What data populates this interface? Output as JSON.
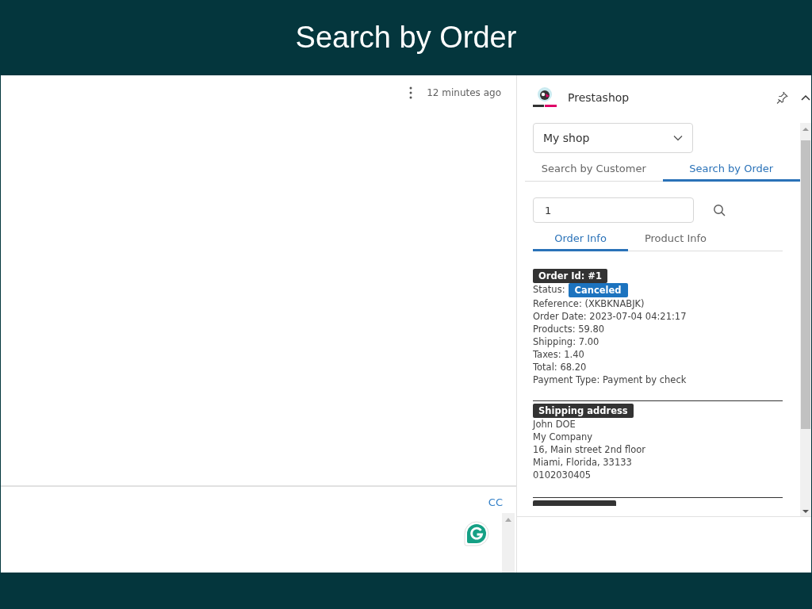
{
  "banner": {
    "title": "Search by Order"
  },
  "message": {
    "time": "12 minutes ago",
    "cc": "CC"
  },
  "panel": {
    "title": "Prestashop",
    "shop_select": {
      "value": "My shop"
    },
    "tabs": [
      {
        "label": "Search by Customer",
        "selected": false
      },
      {
        "label": "Search by Order",
        "selected": true
      }
    ],
    "search": {
      "value": "1"
    },
    "sub_tabs": [
      {
        "label": "Order Info",
        "selected": true
      },
      {
        "label": "Product Info",
        "selected": false
      }
    ],
    "order": {
      "heading": "Order Id: #1",
      "status_label": "Status:",
      "status": "Canceled",
      "lines": [
        "Reference: (XKBKNABJK)",
        "Order Date: 2023-07-04 04:21:17",
        "Products: 59.80",
        "Shipping: 7.00",
        "Taxes: 1.40",
        "Total: 68.20",
        "Payment Type: Payment by check"
      ]
    },
    "shipping": {
      "heading": "Shipping address",
      "lines": [
        "John DOE",
        "My Company",
        "16, Main street 2nd floor",
        "Miami, Florida, 33133",
        "0102030405"
      ]
    }
  }
}
